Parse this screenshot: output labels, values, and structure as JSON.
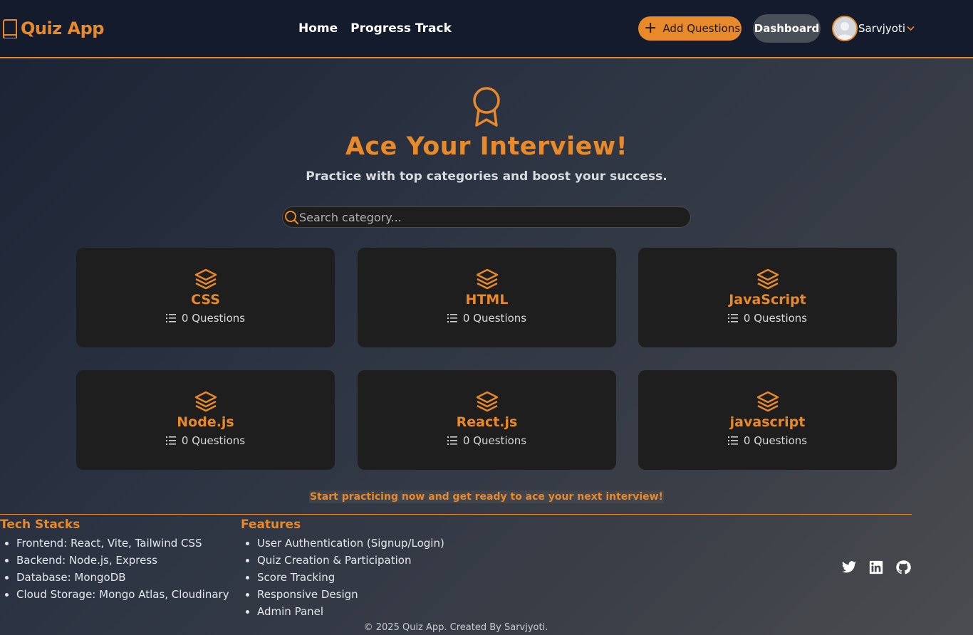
{
  "nav": {
    "brand": "Quiz App",
    "links": [
      "Home",
      "Progress Track"
    ],
    "add_label": "Add Questions",
    "dashboard_label": "Dashboard",
    "username": "Sarvjyoti"
  },
  "hero": {
    "title": "Ace Your Interview!",
    "subtitle": "Practice with top categories and boost your success."
  },
  "search": {
    "placeholder": "Search category..."
  },
  "categories": [
    {
      "name": "CSS",
      "count": "0 Questions"
    },
    {
      "name": "HTML",
      "count": "0 Questions"
    },
    {
      "name": "JavaScript",
      "count": "0 Questions"
    },
    {
      "name": "Node.js",
      "count": "0 Questions"
    },
    {
      "name": "React.js",
      "count": "0 Questions"
    },
    {
      "name": "javascript",
      "count": "0 Questions"
    }
  ],
  "cta": "Start practicing now and get ready to ace your next interview!",
  "footer": {
    "tech_title": "Tech Stacks",
    "tech_items": [
      "Frontend: React, Vite, Tailwind CSS",
      "Backend: Node.js, Express",
      "Database: MongoDB",
      "Cloud Storage: Mongo Atlas, Cloudinary"
    ],
    "features_title": "Features",
    "features_items": [
      "User Authentication (Signup/Login)",
      "Quiz Creation & Participation",
      "Score Tracking",
      "Responsive Design",
      "Admin Panel"
    ],
    "socials": [
      "twitter-icon",
      "linkedin-icon",
      "github-icon"
    ],
    "copyright": "© 2025 Quiz App. Created By Sarvjyoti."
  },
  "colors": {
    "accent": "#e8892a",
    "card": "#1e1e1e",
    "navbar": "#131b2c"
  }
}
